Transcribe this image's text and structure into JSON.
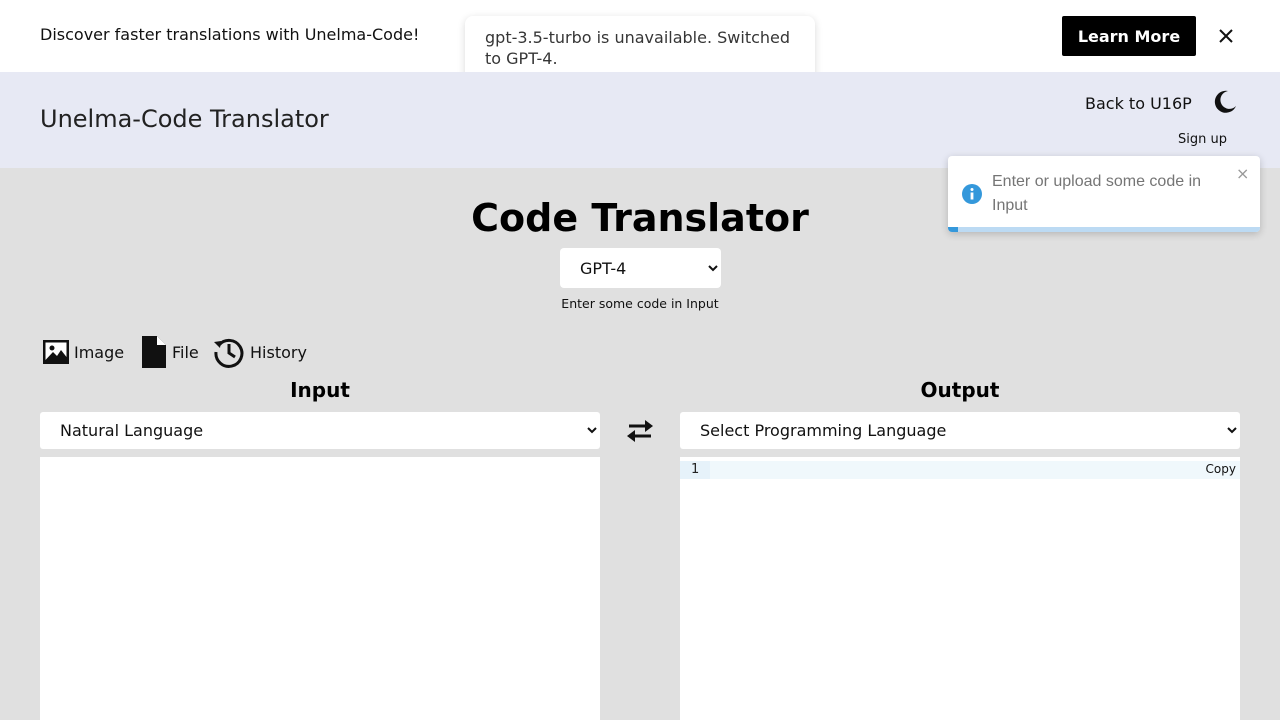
{
  "banner": {
    "text": "Discover faster translations with Unelma-Code!",
    "learn_more": "Learn More",
    "close": "×"
  },
  "toast_top": {
    "message": "gpt-3.5-turbo is unavailable. Switched to GPT-4."
  },
  "header": {
    "title": "Unelma-Code Translator",
    "back_link": "Back to U16P",
    "sign_up": "Sign up"
  },
  "toast_info": {
    "message": "Enter or upload some code in Input",
    "close": "×"
  },
  "main": {
    "title": "Code Translator",
    "model_selected": "GPT-4",
    "hint": "Enter some code in Input"
  },
  "tools": {
    "image": "Image",
    "file": "File",
    "history": "History"
  },
  "input": {
    "heading": "Input",
    "language_selected": "Natural Language"
  },
  "output": {
    "heading": "Output",
    "language_selected": "Select Programming Language",
    "line_number": "1",
    "copy": "Copy"
  },
  "colors": {
    "header_bg": "#e7e9f4",
    "page_bg": "#e0e0e0",
    "info_accent": "#3498db"
  }
}
